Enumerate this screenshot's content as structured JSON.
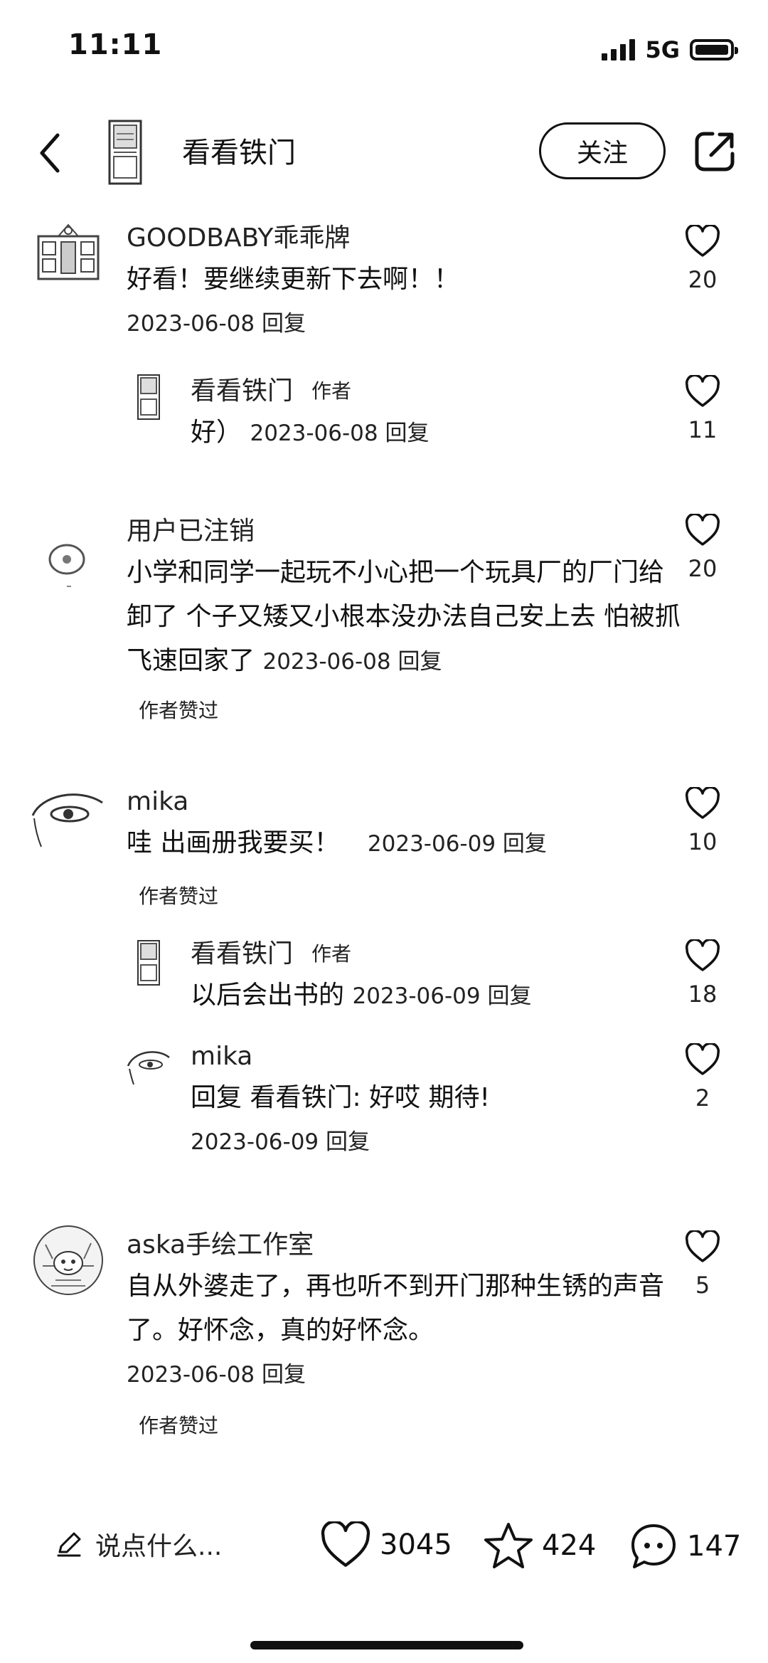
{
  "status_bar": {
    "time": "11:11",
    "network": "5G"
  },
  "header": {
    "title": "看看铁门",
    "follow_label": "关注"
  },
  "comments": [
    {
      "user": "GOODBABY乖乖牌",
      "text": "好看！要继续更新下去啊！！",
      "date": "2023-06-08 回复",
      "likes": "20",
      "replies": [
        {
          "user": "看看铁门",
          "author_tag": "作者",
          "text": "好）",
          "date": "2023-06-08 回复",
          "likes": "11"
        }
      ]
    },
    {
      "user": "用户已注销",
      "text": "小学和同学一起玩不小心把一个玩具厂的厂门给卸了 个子又矮又小根本没办法自己安上去  怕被抓飞速回家了",
      "date": "2023-06-08 回复",
      "likes": "20",
      "liked_by_author": "作者赞过"
    },
    {
      "user": "mika",
      "text": "哇 出画册我要买！",
      "date": "2023-06-09 回复",
      "likes": "10",
      "liked_by_author": "作者赞过",
      "replies": [
        {
          "user": "看看铁门",
          "author_tag": "作者",
          "text": "以后会出书的",
          "date": "2023-06-09 回复",
          "likes": "18"
        },
        {
          "user": "mika",
          "text": "回复 看看铁门: 好哎 期待!",
          "date": "2023-06-09 回复",
          "likes": "2"
        }
      ]
    },
    {
      "user": "aska手绘工作室",
      "text": "自从外婆走了，再也听不到开门那种生锈的声音了。好怀念，真的好怀念。",
      "date": "2023-06-08 回复",
      "likes": "5",
      "liked_by_author": "作者赞过"
    }
  ],
  "bottom_bar": {
    "input_placeholder": "说点什么...",
    "like_count": "3045",
    "favorite_count": "424",
    "comment_count": "147"
  }
}
